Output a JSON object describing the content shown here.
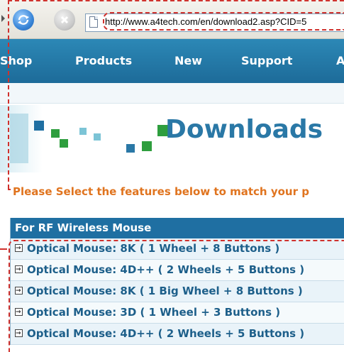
{
  "browser": {
    "url": "http://www.a4tech.com/en/download2.asp?CID=5"
  },
  "nav": {
    "items": [
      "Shop",
      "Products",
      "New",
      "Support",
      "A"
    ]
  },
  "banner": {
    "title": "Downloads"
  },
  "instruction": "Please Select the features below to match your p",
  "table": {
    "header": "For RF Wireless Mouse",
    "rows": [
      "Optical Mouse: 8K ( 1 Wheel + 8 Buttons )",
      "Optical Mouse: 4D++ ( 2 Wheels + 5 Buttons )",
      "Optical Mouse: 8K ( 1 Big Wheel + 8 Buttons )",
      "Optical Mouse: 3D ( 1 Wheel + 3 Buttons )",
      "Optical Mouse: 4D++ ( 2 Wheels + 5 Buttons )"
    ]
  },
  "colors": {
    "nav_bg": "#1d6b99",
    "banner_title": "#2a78a6",
    "instruction": "#e0741f",
    "highlight": "#d0312d"
  }
}
